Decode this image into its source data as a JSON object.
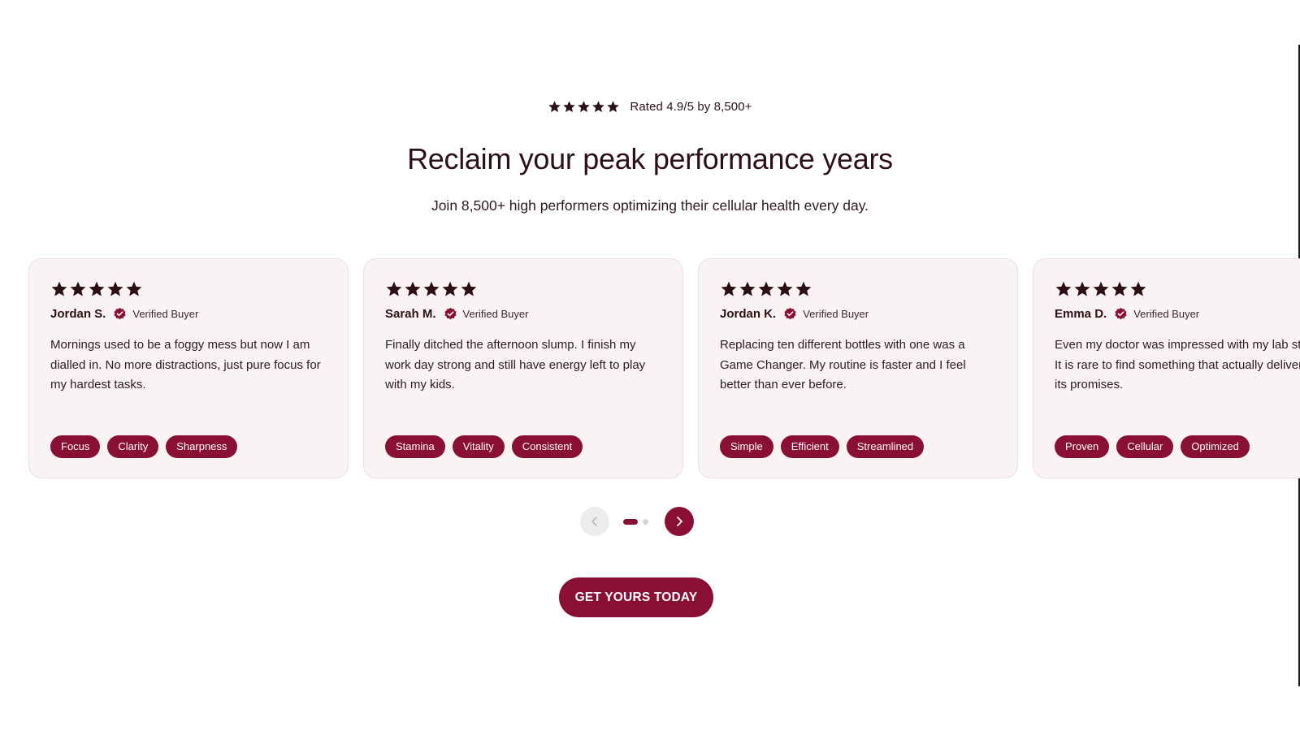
{
  "summary": {
    "star_count": 5,
    "rating_text": "Rated 4.9/5 by 8,500+"
  },
  "headline": "Reclaim your peak performance years",
  "subhead": "Join 8,500+ high performers optimizing their cellular health every day.",
  "colors": {
    "brand": "#8a0f35",
    "star": "#2d0f16",
    "card_bg": "#faf3f3"
  },
  "reviews": [
    {
      "rating": 5,
      "name": "Jordan S.",
      "badge": "Verified Buyer",
      "text": "Mornings used to be a foggy mess but now I am dialled in. No more distractions, just pure focus for my hardest tasks.",
      "tags": [
        "Focus",
        "Clarity",
        "Sharpness"
      ]
    },
    {
      "rating": 5,
      "name": "Sarah M.",
      "badge": "Verified Buyer",
      "text": "Finally ditched the afternoon slump. I finish my work day strong and still have energy left to play with my kids.",
      "tags": [
        "Stamina",
        "Vitality",
        "Consistent"
      ]
    },
    {
      "rating": 5,
      "name": "Jordan K.",
      "badge": "Verified Buyer",
      "text": "Replacing ten different bottles with one was a Game Changer. My routine is faster and I feel better than ever before.",
      "tags": [
        "Simple",
        "Efficient",
        "Streamlined"
      ]
    },
    {
      "rating": 5,
      "name": "Emma D.",
      "badge": "Verified Buyer",
      "text": "Even my doctor was impressed with my lab stats. It is rare to find something that actually delivers on its promises.",
      "tags": [
        "Proven",
        "Cellular",
        "Optimized"
      ]
    }
  ],
  "carousel": {
    "prev_icon": "chevron-left-icon",
    "next_icon": "chevron-right-icon",
    "page_count": 2,
    "active_page": 1
  },
  "cta": {
    "label": "GET YOURS TODAY"
  }
}
